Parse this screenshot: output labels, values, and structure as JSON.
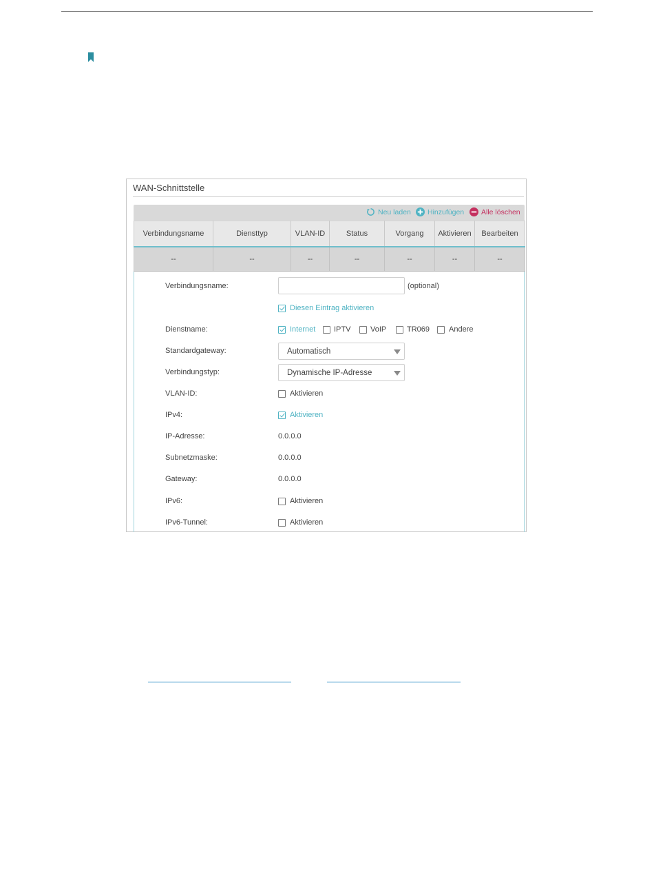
{
  "panel": {
    "title": "WAN-Schnittstelle",
    "toolbar": {
      "reload_label": "Neu laden",
      "add_label": "Hinzufügen",
      "delete_all_label": "Alle löschen"
    },
    "table": {
      "headers": [
        "Verbindungsname",
        "Diensttyp",
        "VLAN-ID",
        "Status",
        "Vorgang",
        "Aktivieren",
        "Bearbeiten"
      ],
      "row": [
        "--",
        "--",
        "--",
        "--",
        "--",
        "--",
        "--"
      ]
    }
  },
  "form": {
    "connection_name": {
      "label": "Verbindungsname:",
      "value": "",
      "hint": "(optional)"
    },
    "enable_entry": {
      "label": "Diesen Eintrag aktivieren",
      "checked": true
    },
    "service_name": {
      "label": "Dienstname:",
      "options": [
        {
          "label": "Internet",
          "checked": true
        },
        {
          "label": "IPTV",
          "checked": false
        },
        {
          "label": "VoIP",
          "checked": false
        },
        {
          "label": "TR069",
          "checked": false
        },
        {
          "label": "Andere",
          "checked": false
        }
      ]
    },
    "default_gateway": {
      "label": "Standardgateway:",
      "value": "Automatisch"
    },
    "connection_type": {
      "label": "Verbindungstyp:",
      "value": "Dynamische IP-Adresse"
    },
    "vlan_id": {
      "label": "VLAN-ID:",
      "checkbox_label": "Aktivieren",
      "checked": false
    },
    "ipv4": {
      "label": "IPv4:",
      "checkbox_label": "Aktivieren",
      "checked": true
    },
    "ip_address": {
      "label": "IP-Adresse:",
      "value": "0.0.0.0"
    },
    "subnet_mask": {
      "label": "Subnetzmaske:",
      "value": "0.0.0.0"
    },
    "gateway": {
      "label": "Gateway:",
      "value": "0.0.0.0"
    },
    "ipv6": {
      "label": "IPv6:",
      "checkbox_label": "Aktivieren",
      "checked": false
    },
    "ipv6_tunnel": {
      "label": "IPv6-Tunnel:",
      "checkbox_label": "Aktivieren",
      "checked": false
    }
  },
  "colors": {
    "accent": "#4fb3c3",
    "danger": "#c4305f",
    "link": "#2f8fc7"
  },
  "icons": {
    "bookmark": "bookmark-icon",
    "reload": "reload-icon",
    "add": "plus-circle-icon",
    "delete": "minus-circle-icon"
  }
}
